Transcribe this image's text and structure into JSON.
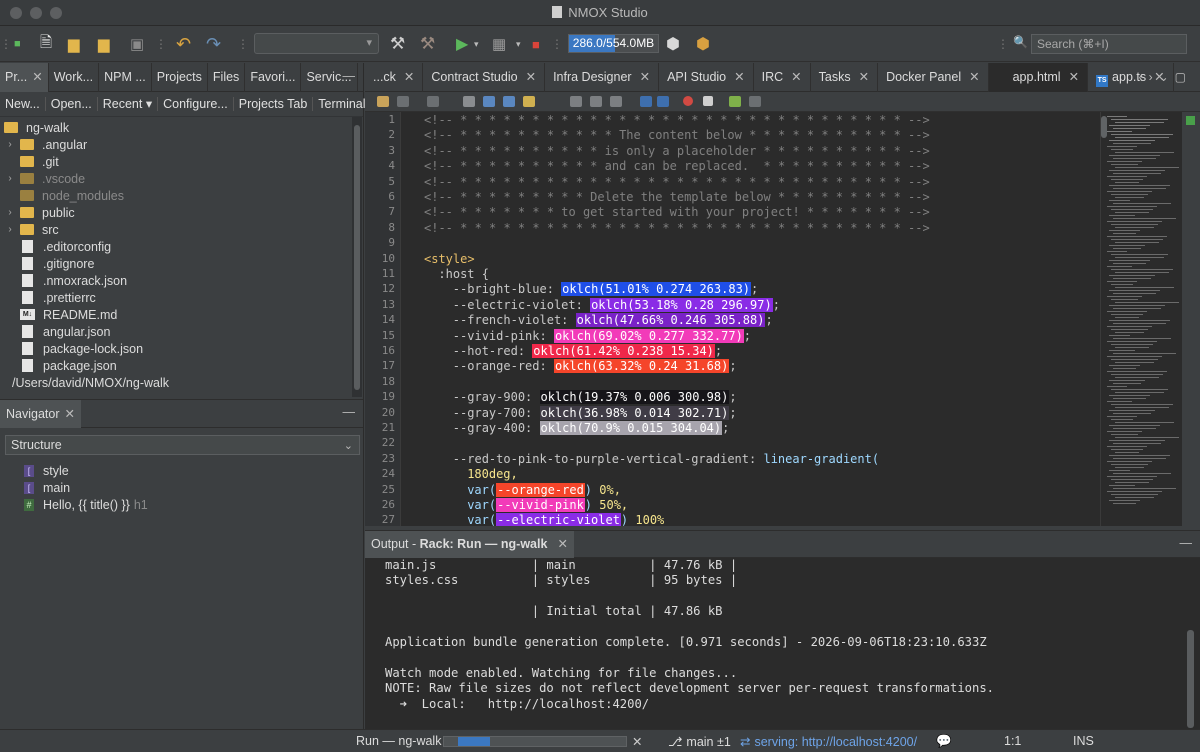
{
  "app": {
    "title": "NMOX Studio"
  },
  "toolbar": {
    "memory": "286.0/554.0MB",
    "memory_fraction": 0.52,
    "search_placeholder": "Search (⌘+I)"
  },
  "left_tabs": [
    "Pr...",
    "Work...",
    "NPM ...",
    "Projects",
    "Files",
    "Favori...",
    "Servic..."
  ],
  "left_actions": [
    "New...",
    "Open...",
    "Recent ▾",
    "Configure...",
    "Projects Tab",
    "Terminal"
  ],
  "tree": {
    "root": "ng-walk",
    "items": [
      {
        "label": ".angular",
        "kind": "folder",
        "expandable": true
      },
      {
        "label": ".git",
        "kind": "folder",
        "expandable": false
      },
      {
        "label": ".vscode",
        "kind": "folder-dim",
        "expandable": true
      },
      {
        "label": "node_modules",
        "kind": "folder-dim",
        "expandable": false
      },
      {
        "label": "public",
        "kind": "folder",
        "expandable": true
      },
      {
        "label": "src",
        "kind": "folder",
        "expandable": true
      },
      {
        "label": ".editorconfig",
        "kind": "file"
      },
      {
        "label": ".gitignore",
        "kind": "file"
      },
      {
        "label": ".nmoxrack.json",
        "kind": "file"
      },
      {
        "label": ".prettierrc",
        "kind": "file"
      },
      {
        "label": "README.md",
        "kind": "md"
      },
      {
        "label": "angular.json",
        "kind": "file"
      },
      {
        "label": "package-lock.json",
        "kind": "file"
      },
      {
        "label": "package.json",
        "kind": "file"
      }
    ],
    "path": "/Users/david/NMOX/ng-walk"
  },
  "navigator": {
    "tab": "Navigator",
    "select": "Structure",
    "items": [
      {
        "icon": "[",
        "label": "style",
        "extra": ""
      },
      {
        "icon": "[",
        "label": "main",
        "extra": ""
      },
      {
        "icon": "#",
        "label": "Hello, {{ title() }}",
        "extra": "h1"
      }
    ]
  },
  "editor_tabs": [
    "...ck",
    "Contract Studio",
    "Infra Designer",
    "API Studio",
    "IRC",
    "Tasks",
    "Docker Panel",
    "app.html",
    "app.ts"
  ],
  "code": {
    "line_numbers": [
      "1",
      "2",
      "3",
      "4",
      "5",
      "6",
      "7",
      "8",
      "9",
      "10",
      "11",
      "12",
      "13",
      "14",
      "15",
      "16",
      "17",
      "18",
      "19",
      "20",
      "21",
      "22",
      "23",
      "24",
      "25",
      "26",
      "27"
    ],
    "comments": [
      "<!-- * * * * * * * * * * * * * * * * * * * * * * * * * * * * * * * -->",
      "<!-- * * * * * * * * * * * The content below * * * * * * * * * * * -->",
      "<!-- * * * * * * * * * * is only a placeholder * * * * * * * * * * -->",
      "<!-- * * * * * * * * * * and can be replaced.  * * * * * * * * * * -->",
      "<!-- * * * * * * * * * * * * * * * * * * * * * * * * * * * * * * * -->",
      "<!-- * * * * * * * * * Delete the template below * * * * * * * * * -->",
      "<!-- * * * * * * * to get started with your project! * * * * * * * -->",
      "<!-- * * * * * * * * * * * * * * * * * * * * * * * * * * * * * * * -->"
    ],
    "style_open": "<style>",
    "host": ":host {",
    "color_vars": [
      {
        "name": "--bright-blue: ",
        "value": "oklch(51.01% 0.274 263.83)",
        "color": "#1f4fe8"
      },
      {
        "name": "--electric-violet: ",
        "value": "oklch(53.18% 0.28 296.97)",
        "color": "#8a2ce6"
      },
      {
        "name": "--french-violet: ",
        "value": "oklch(47.66% 0.246 305.88)",
        "color": "#7a22c8"
      },
      {
        "name": "--vivid-pink: ",
        "value": "oklch(69.02% 0.277 332.77)",
        "color": "#f23bb9"
      },
      {
        "name": "--hot-red: ",
        "value": "oklch(61.42% 0.238 15.34)",
        "color": "#f0284a"
      },
      {
        "name": "--orange-red: ",
        "value": "oklch(63.32% 0.24 31.68)",
        "color": "#f5452a"
      }
    ],
    "gray_vars": [
      {
        "name": "--gray-900: ",
        "value": "oklch(19.37% 0.006 300.98)",
        "color": "#161519"
      },
      {
        "name": "--gray-700: ",
        "value": "oklch(36.98% 0.014 302.71)",
        "color": "#403c46"
      },
      {
        "name": "--gray-400: ",
        "value": "oklch(70.9% 0.015 304.04)",
        "color": "#a7a4ad"
      }
    ],
    "gradient_name": "--red-to-pink-to-purple-vertical-gradient: ",
    "gradient_fn": "linear-gradient(",
    "deg": "180deg,",
    "stops": [
      {
        "var": "--orange-red",
        "pct": " 0%,",
        "color": "#f5452a"
      },
      {
        "var": "--vivid-pink",
        "pct": " 50%,",
        "color": "#f23bb9"
      },
      {
        "var": "--electric-violet",
        "pct": " 100%",
        "color": "#8a2ce6"
      }
    ]
  },
  "output": {
    "tab_prefix": "Output - ",
    "tab_bold": "Rack: Run — ng-walk",
    "lines": [
      "main.js             | main          | 47.76 kB |",
      "styles.css          | styles        | 95 bytes |",
      "",
      "                    | Initial total | 47.86 kB",
      "",
      "Application bundle generation complete. [0.971 seconds] - 2026-09-06T18:23:10.633Z",
      "",
      "Watch mode enabled. Watching for file changes...",
      "NOTE: Raw file sizes do not reflect development server per-request transformations.",
      "  ➜  Local:   http://localhost:4200/"
    ]
  },
  "status": {
    "run": "Run — ng-walk",
    "branch": "main ±1",
    "serving": "serving: http://localhost:4200/",
    "position": "1:1",
    "mode": "INS"
  }
}
